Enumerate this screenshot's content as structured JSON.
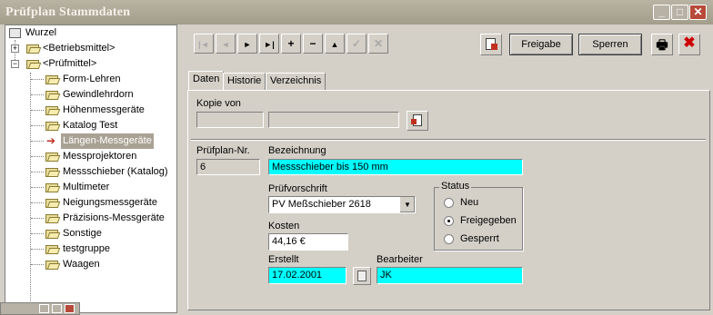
{
  "window": {
    "title": "Prüfplan Stammdaten"
  },
  "tree": {
    "root": "Wurzel",
    "groups": [
      {
        "label": "<Betriebsmittel>",
        "expanded": false
      },
      {
        "label": "<Prüfmittel>",
        "expanded": true
      }
    ],
    "items": [
      "Form-Lehren",
      "Gewindlehrdorn",
      "Höhenmessgeräte",
      "Katalog Test",
      "Längen-Messgeräte",
      "Messprojektoren",
      "Messschieber (Katalog)",
      "Multimeter",
      "Neigungsmessgeräte",
      "Präzisions-Messgeräte",
      "Sonstige",
      "testgruppe",
      "Waagen"
    ],
    "selected_item": "Längen-Messgeräte"
  },
  "toolbar": {
    "nav_first": "|◄",
    "nav_prev": "◄",
    "nav_next": "►",
    "nav_last": "►|",
    "add": "+",
    "remove": "−",
    "up": "▲",
    "confirm": "✓",
    "cancel": "✕",
    "freigabe_label": "Freigabe",
    "sperren_label": "Sperren"
  },
  "tabs": [
    {
      "label": "Daten",
      "active": true
    },
    {
      "label": "Historie",
      "active": false
    },
    {
      "label": "Verzeichnis",
      "active": false
    }
  ],
  "form": {
    "kopie_von_label": "Kopie von",
    "kopie_von_value1": "",
    "kopie_von_value2": "",
    "pruefplan_nr_label": "Prüfplan-Nr.",
    "pruefplan_nr_value": "6",
    "bezeichnung_label": "Bezeichnung",
    "bezeichnung_value": "Messschieber bis 150 mm",
    "pruefvorschrift_label": "Prüfvorschrift",
    "pruefvorschrift_value": "PV Meßschieber 2618",
    "kosten_label": "Kosten",
    "kosten_value": "44,16 €",
    "erstellt_label": "Erstellt",
    "erstellt_value": "17.02.2001",
    "bearbeiter_label": "Bearbeiter",
    "bearbeiter_value": "JK",
    "status_label": "Status",
    "status_options": [
      "Neu",
      "Freigegeben",
      "Gesperrt"
    ],
    "status_selected": "Freigegeben"
  },
  "colors": {
    "highlight_field": "#00ffff",
    "close_button": "#cc0000",
    "window_bg": "#d4d0c8"
  }
}
